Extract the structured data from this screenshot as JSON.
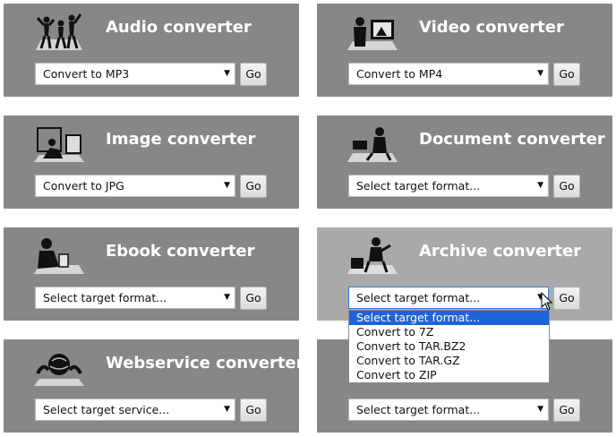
{
  "panels": [
    {
      "key": "audio",
      "title": "Audio converter",
      "selected": "Convert to MP3",
      "go": "Go",
      "icon": "dancers-icon"
    },
    {
      "key": "video",
      "title": "Video converter",
      "selected": "Convert to MP4",
      "go": "Go",
      "icon": "video-viewer-icon"
    },
    {
      "key": "image",
      "title": "Image converter",
      "selected": "Convert to JPG",
      "go": "Go",
      "icon": "photo-frames-icon"
    },
    {
      "key": "document",
      "title": "Document converter",
      "selected": "Select target format...",
      "go": "Go",
      "icon": "reader-at-desk-icon"
    },
    {
      "key": "ebook",
      "title": "Ebook converter",
      "selected": "Select target format...",
      "go": "Go",
      "icon": "ebook-reader-icon"
    },
    {
      "key": "archive",
      "title": "Archive converter",
      "selected": "Select target format...",
      "go": "Go",
      "icon": "archive-box-icon"
    },
    {
      "key": "webservice",
      "title": "Webservice converter",
      "selected": "Select target service...",
      "go": "Go",
      "icon": "globe-hands-icon"
    },
    {
      "key": "hash",
      "title": "",
      "selected": "Select target format...",
      "go": "Go",
      "icon": ""
    }
  ],
  "archive_dropdown": {
    "options": [
      "Select target format...",
      "Convert to 7Z",
      "Convert to TAR.BZ2",
      "Convert to TAR.GZ",
      "Convert to ZIP"
    ],
    "highlighted_index": 0
  },
  "colors": {
    "panel_bg": "#878787",
    "panel_active_bg": "#a9a9a9",
    "highlight": "#1e64d8"
  }
}
